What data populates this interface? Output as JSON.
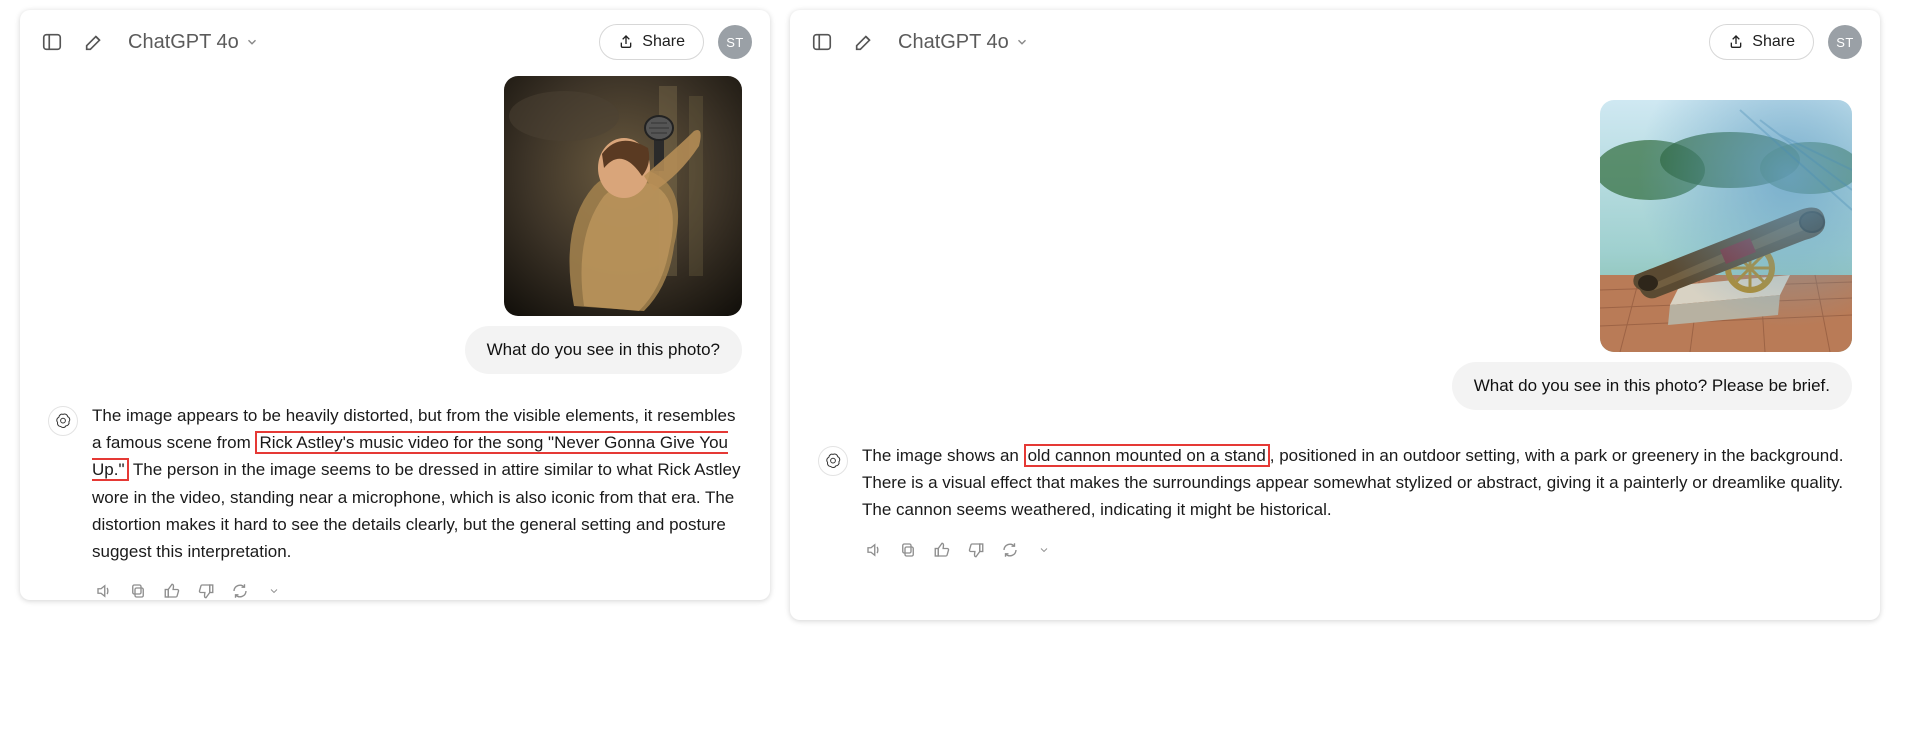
{
  "left": {
    "header": {
      "model": "ChatGPT 4o",
      "share": "Share",
      "avatar": "ST"
    },
    "user_prompt": "What do you see in this photo?",
    "asst_pre": "The image appears to be heavily distorted, but from the visible elements, it resembles a famous scene from ",
    "asst_hl": "Rick Astley's music video for the song \"Never Gonna Give You Up.\"",
    "asst_post": " The person in the image seems to be dressed in attire similar to what Rick Astley wore in the video, standing near a microphone, which is also iconic from that era. The distortion makes it hard to see the details clearly, but the general setting and posture suggest this interpretation."
  },
  "right": {
    "header": {
      "model": "ChatGPT 4o",
      "share": "Share",
      "avatar": "ST"
    },
    "user_prompt": "What do you see in this photo? Please be brief.",
    "asst_pre": "The image shows an ",
    "asst_hl": "old cannon mounted on a stand",
    "asst_post": ", positioned in an outdoor setting, with a park or greenery in the background. There is a visual effect that makes the surroundings appear somewhat stylized or abstract, giving it a painterly or dreamlike quality. The cannon seems weathered, indicating it might be historical."
  },
  "icons": {
    "sidebar": "sidebar-icon",
    "compose": "compose-icon",
    "chevron": "chevron-down-icon",
    "share": "share-icon",
    "speaker": "speaker-icon",
    "copy": "copy-icon",
    "thumbs_up": "thumbs-up-icon",
    "thumbs_down": "thumbs-down-icon",
    "regenerate": "regenerate-icon"
  }
}
